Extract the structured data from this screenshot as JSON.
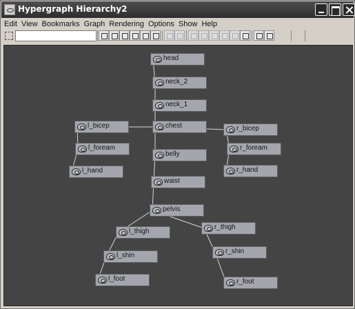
{
  "window": {
    "title": "Hypergraph Hierarchy2"
  },
  "menubar": {
    "items": [
      "Edit",
      "View",
      "Bookmarks",
      "Graph",
      "Rendering",
      "Options",
      "Show",
      "Help"
    ]
  },
  "toolbar": {
    "search_value": "",
    "icons": [
      "frame-all-icon",
      "frame-selection-icon",
      "frame-hierarchy-icon",
      "frame-branch-icon",
      "previous-view-icon",
      "next-view-icon",
      "input-output-icon",
      "scene-hierarchy-icon",
      "show-dependencies-icon",
      "show-connections-icon",
      "toggle-swatches-icon",
      "render-swatch-icon",
      "graph-layout-icon",
      "bookmark-icon",
      "add-bookmark-icon",
      "clear-view-icon"
    ]
  },
  "graph": {
    "nodes": [
      {
        "id": "head",
        "label": "head"
      },
      {
        "id": "neck_2",
        "label": "neck_2"
      },
      {
        "id": "neck_1",
        "label": "neck_1"
      },
      {
        "id": "chest",
        "label": "chest"
      },
      {
        "id": "l_bicep",
        "label": "l_bicep"
      },
      {
        "id": "r_bicep",
        "label": "r_bicep"
      },
      {
        "id": "l_foream",
        "label": "l_foream"
      },
      {
        "id": "r_foream",
        "label": "r_foream"
      },
      {
        "id": "belly",
        "label": "belly"
      },
      {
        "id": "l_hand",
        "label": "l_hand"
      },
      {
        "id": "r_hand",
        "label": "r_hand"
      },
      {
        "id": "waist",
        "label": "waist"
      },
      {
        "id": "pelvis",
        "label": "pelvis"
      },
      {
        "id": "r_thigh",
        "label": "r_thigh"
      },
      {
        "id": "l_thigh",
        "label": "l_thigh"
      },
      {
        "id": "r_shin",
        "label": "r_shin"
      },
      {
        "id": "l_shin",
        "label": "l_shin"
      },
      {
        "id": "l_foot",
        "label": "l_foot"
      },
      {
        "id": "r_foot",
        "label": "r_foot"
      }
    ],
    "edges": [
      [
        "neck_2",
        "head"
      ],
      [
        "neck_1",
        "neck_2"
      ],
      [
        "chest",
        "neck_1"
      ],
      [
        "chest",
        "l_bicep"
      ],
      [
        "chest",
        "r_bicep"
      ],
      [
        "l_bicep",
        "l_foream"
      ],
      [
        "l_foream",
        "l_hand"
      ],
      [
        "r_bicep",
        "r_foream"
      ],
      [
        "r_foream",
        "r_hand"
      ],
      [
        "belly",
        "chest"
      ],
      [
        "waist",
        "belly"
      ],
      [
        "pelvis",
        "waist"
      ],
      [
        "pelvis",
        "l_thigh"
      ],
      [
        "pelvis",
        "r_thigh"
      ],
      [
        "l_thigh",
        "l_shin"
      ],
      [
        "l_shin",
        "l_foot"
      ],
      [
        "r_thigh",
        "r_shin"
      ],
      [
        "r_shin",
        "r_foot"
      ]
    ]
  }
}
